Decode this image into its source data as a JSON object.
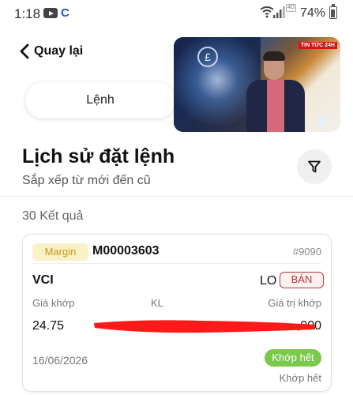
{
  "status_bar": {
    "time": "1:18",
    "network_badge": "4G",
    "battery": "74%"
  },
  "nav": {
    "back_label": "Quay lại",
    "tab_label": "Lệnh"
  },
  "video": {
    "badge": "TIN TỨC 24H"
  },
  "header": {
    "title": "Lịch sử đặt lệnh",
    "subtitle": "Sắp xếp từ mới đến cũ"
  },
  "results": {
    "count_text": "30 Kết quả"
  },
  "order": {
    "account_type": "Margin",
    "order_id": "M00003603",
    "order_number": "#9090",
    "symbol": "VCI",
    "order_type": "LO",
    "side": "BÁN",
    "labels": {
      "price": "Giá khớp",
      "quantity": "KL",
      "value": "Giá trị khớp"
    },
    "matched_price": "24.75",
    "matched_value_visible": ",000",
    "date": "16/06/2026",
    "status_badge": "Khớp hết",
    "status_text": "Khớp hết"
  },
  "colors": {
    "margin_badge_bg": "#fbf1c8",
    "margin_badge_text": "#c49a16",
    "sell_color": "#b33a3a",
    "matched_green": "#7ac94b"
  }
}
